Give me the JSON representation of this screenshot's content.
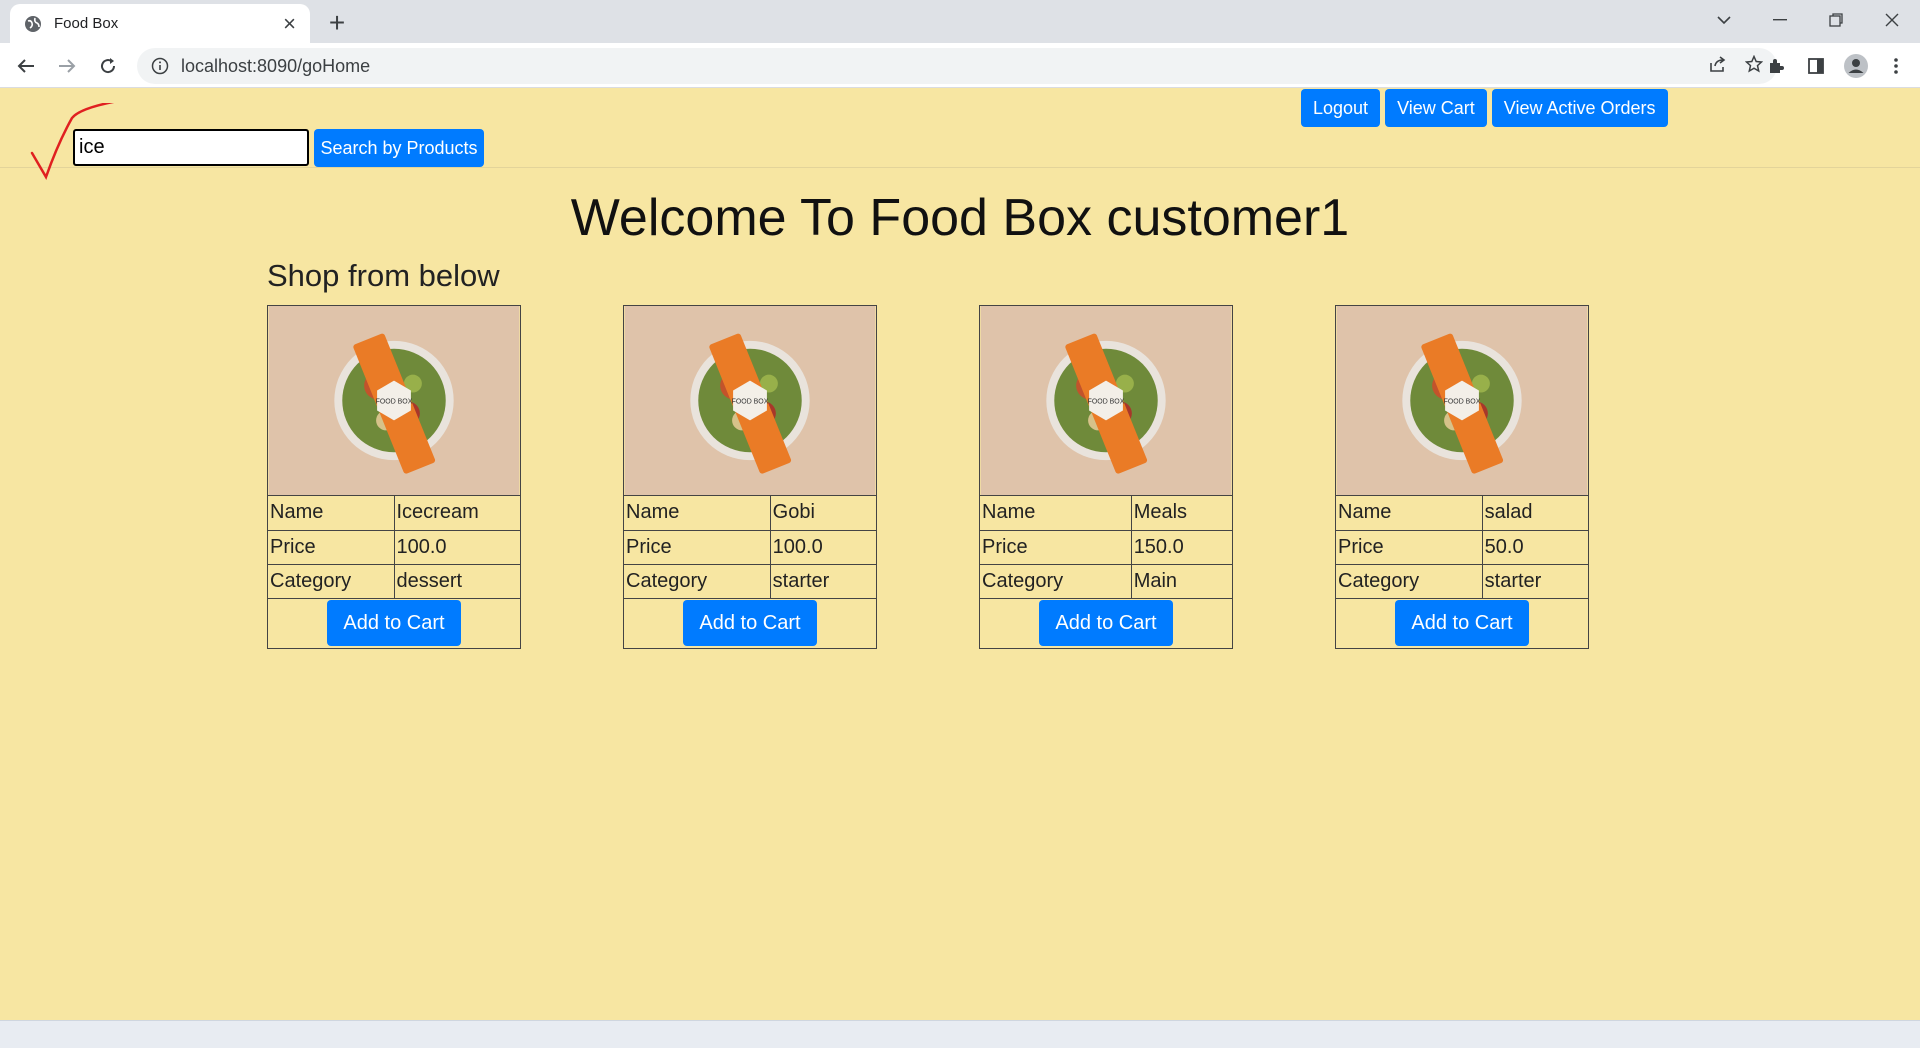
{
  "browser": {
    "tab_title": "Food Box",
    "url": "localhost:8090/goHome"
  },
  "header": {
    "search_value": "ice",
    "search_button": "Search by Products",
    "logout": "Logout",
    "view_cart": "View Cart",
    "view_orders": "View Active Orders"
  },
  "main": {
    "welcome": "Welcome To Food Box customer1",
    "shop_heading": "Shop from below",
    "products": [
      {
        "name_label": "Name",
        "name": "Icecream",
        "price_label": "Price",
        "price": "100.0",
        "category_label": "Category",
        "category": "dessert",
        "add_label": "Add to Cart"
      },
      {
        "name_label": "Name",
        "name": "Gobi",
        "price_label": "Price",
        "price": "100.0",
        "category_label": "Category",
        "category": "starter",
        "add_label": "Add to Cart"
      },
      {
        "name_label": "Name",
        "name": "Meals",
        "price_label": "Price",
        "price": "150.0",
        "category_label": "Category",
        "category": "Main",
        "add_label": "Add to Cart"
      },
      {
        "name_label": "Name",
        "name": "salad",
        "price_label": "Price",
        "price": "50.0",
        "category_label": "Category",
        "category": "starter",
        "add_label": "Add to Cart"
      }
    ],
    "product_image_text": "FOOD BOX"
  },
  "colors": {
    "page_bg": "#f7e6a2",
    "button": "#007bff",
    "annotation": "#e02020"
  }
}
